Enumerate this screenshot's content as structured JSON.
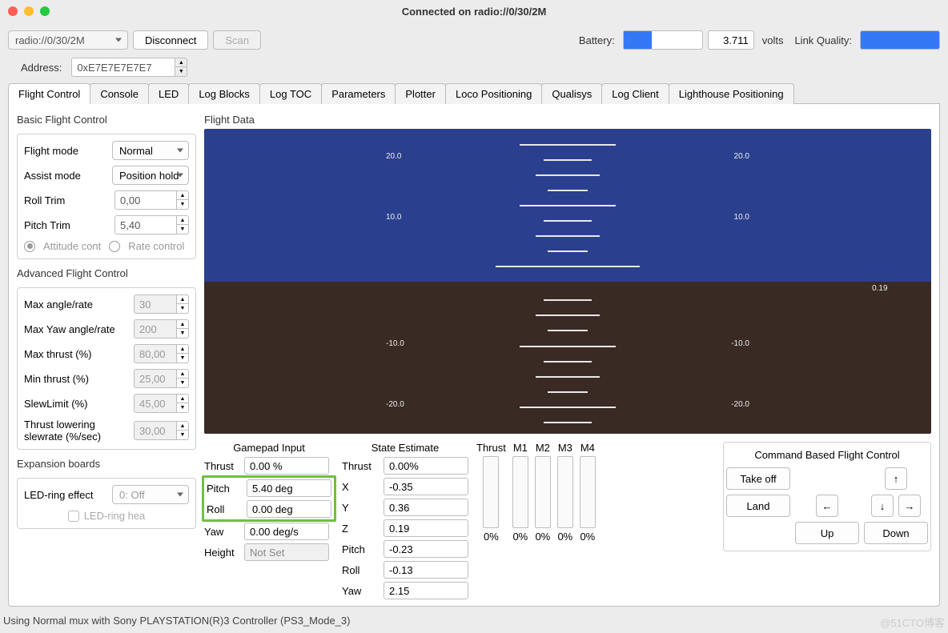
{
  "title": "Connected on radio://0/30/2M",
  "connection": {
    "uri": "radio://0/30/2M",
    "disconnect": "Disconnect",
    "scan": "Scan"
  },
  "battery": {
    "label": "Battery:",
    "value": "3.711",
    "unit": "volts",
    "fill_percent": 36
  },
  "link": {
    "label": "Link Quality:"
  },
  "address": {
    "label": "Address:",
    "value": "0xE7E7E7E7E7"
  },
  "tabs": [
    "Flight Control",
    "Console",
    "LED",
    "Log Blocks",
    "Log TOC",
    "Parameters",
    "Plotter",
    "Loco Positioning",
    "Qualisys",
    "Log Client",
    "Lighthouse Positioning"
  ],
  "basic": {
    "title": "Basic Flight Control",
    "flight_mode": {
      "label": "Flight mode",
      "value": "Normal"
    },
    "assist_mode": {
      "label": "Assist mode",
      "value": "Position hold"
    },
    "roll_trim": {
      "label": "Roll Trim",
      "value": "0,00"
    },
    "pitch_trim": {
      "label": "Pitch Trim",
      "value": "5,40"
    },
    "attitude": "Attitude cont",
    "rate": "Rate control"
  },
  "advanced": {
    "title": "Advanced Flight Control",
    "max_angle": {
      "label": "Max angle/rate",
      "value": "30"
    },
    "max_yaw": {
      "label": "Max Yaw angle/rate",
      "value": "200"
    },
    "max_thrust": {
      "label": "Max thrust (%)",
      "value": "80,00"
    },
    "min_thrust": {
      "label": "Min thrust (%)",
      "value": "25,00"
    },
    "slew_limit": {
      "label": "SlewLimit (%)",
      "value": "45,00"
    },
    "slew_rate": {
      "label": "Thrust lowering slewrate (%/sec)",
      "value": "30,00"
    }
  },
  "expansion": {
    "title": "Expansion boards",
    "led_ring": {
      "label": "LED-ring effect",
      "value": "0: Off"
    },
    "led_headlight": "LED-ring hea"
  },
  "flight_data": {
    "title": "Flight Data",
    "axis_value": "0.19",
    "ticks": [
      "20.0",
      "10.0",
      "-10.0",
      "-20.0"
    ]
  },
  "gamepad": {
    "title": "Gamepad Input",
    "thrust": {
      "label": "Thrust",
      "value": "0.00 %"
    },
    "pitch": {
      "label": "Pitch",
      "value": "5.40 deg"
    },
    "roll": {
      "label": "Roll",
      "value": "0.00 deg"
    },
    "yaw": {
      "label": "Yaw",
      "value": "0.00 deg/s"
    },
    "height": {
      "label": "Height",
      "value": "Not Set"
    }
  },
  "state": {
    "title": "State Estimate",
    "thrust": {
      "label": "Thrust",
      "value": "0.00%"
    },
    "x": {
      "label": "X",
      "value": "-0.35"
    },
    "y": {
      "label": "Y",
      "value": "0.36"
    },
    "z": {
      "label": "Z",
      "value": "0.19"
    },
    "pitch": {
      "label": "Pitch",
      "value": "-0.23"
    },
    "roll": {
      "label": "Roll",
      "value": "-0.13"
    },
    "yaw": {
      "label": "Yaw",
      "value": "2.15"
    }
  },
  "motors": {
    "labels": [
      "Thrust",
      "M1",
      "M2",
      "M3",
      "M4"
    ],
    "values": [
      "0%",
      "0%",
      "0%",
      "0%",
      "0%"
    ]
  },
  "command": {
    "title": "Command Based Flight Control",
    "takeoff": "Take off",
    "land": "Land",
    "up": "Up",
    "down": "Down",
    "arrows": {
      "up": "↑",
      "down": "↓",
      "left": "←",
      "right": "→"
    }
  },
  "status": "Using Normal mux with Sony PLAYSTATION(R)3 Controller (PS3_Mode_3)",
  "watermark": "@51CTO博客"
}
